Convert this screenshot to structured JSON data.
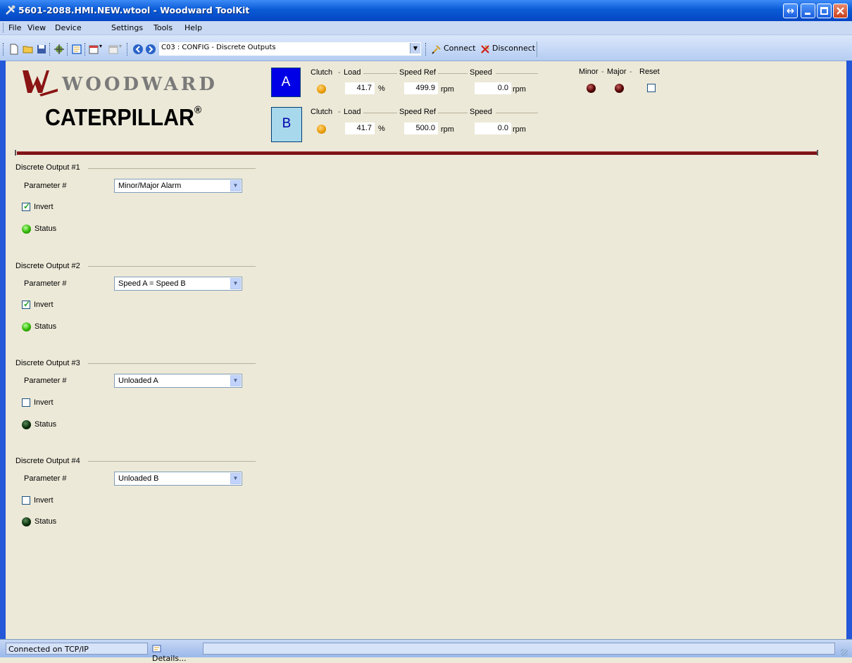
{
  "window": {
    "title": "5601-2088.HMI.NEW.wtool - Woodward ToolKit"
  },
  "menu": {
    "items": [
      "File",
      "View",
      "Device",
      "Settings",
      "Tools",
      "Help"
    ]
  },
  "toolbar": {
    "screen_selector": "C03 : CONFIG - Discrete Outputs",
    "connect_label": "Connect",
    "disconnect_label": "Disconnect"
  },
  "logos": {
    "woodward": "WOODWARD",
    "caterpillar": "CATERPILLAR",
    "registered": "®"
  },
  "units": [
    {
      "button": "A",
      "headers": {
        "clutch": "Clutch",
        "load": "Load",
        "speed_ref": "Speed Ref",
        "speed": "Speed"
      },
      "load": "41.7",
      "load_unit": "%",
      "speed_ref": "499.9",
      "speed_ref_unit": "rpm",
      "speed": "0.0",
      "speed_unit": "rpm",
      "clutch_color": "#e89a00"
    },
    {
      "button": "B",
      "headers": {
        "clutch": "Clutch",
        "load": "Load",
        "speed_ref": "Speed Ref",
        "speed": "Speed"
      },
      "load": "41.7",
      "load_unit": "%",
      "speed_ref": "500.0",
      "speed_ref_unit": "rpm",
      "speed": "0.0",
      "speed_unit": "rpm",
      "clutch_color": "#e89a00"
    }
  ],
  "alarms": {
    "minor_label": "Minor",
    "major_label": "Major",
    "reset_label": "Reset"
  },
  "outputs": [
    {
      "title": "Discrete Output #1",
      "param_label": "Parameter #",
      "param_value": "Minor/Major Alarm",
      "invert_label": "Invert",
      "invert_checked": true,
      "status_label": "Status",
      "status_on": true
    },
    {
      "title": "Discrete Output #2",
      "param_label": "Parameter #",
      "param_value": "Speed A = Speed B",
      "invert_label": "Invert",
      "invert_checked": true,
      "status_label": "Status",
      "status_on": true
    },
    {
      "title": "Discrete Output #3",
      "param_label": "Parameter #",
      "param_value": "Unloaded A",
      "invert_label": "Invert",
      "invert_checked": false,
      "status_label": "Status",
      "status_on": false
    },
    {
      "title": "Discrete Output #4",
      "param_label": "Parameter #",
      "param_value": "Unloaded B",
      "invert_label": "Invert",
      "invert_checked": false,
      "status_label": "Status",
      "status_on": false
    }
  ],
  "statusbar": {
    "connection": "Connected on TCP/IP",
    "details_label": "Details..."
  },
  "colors": {
    "titlebar": "#0a5bd6",
    "unit_a_button": "#0000e6",
    "unit_b_button": "#a8d8ec",
    "separator": "#7d1215",
    "panel_bg": "#ece9d8"
  }
}
